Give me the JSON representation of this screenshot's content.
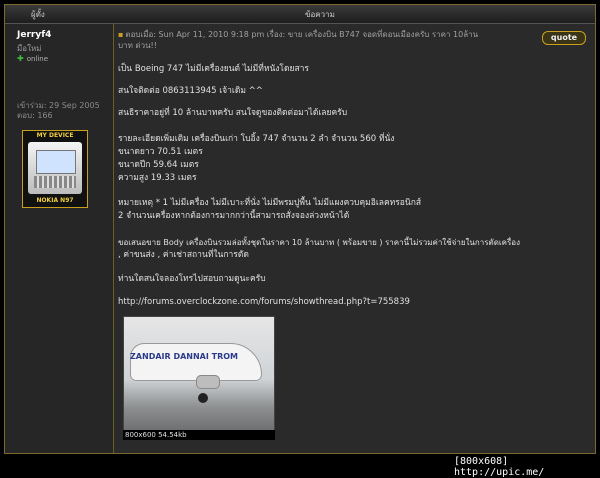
{
  "header": {
    "author": "ผู้ตั้ง",
    "message": "ข้อความ"
  },
  "user": {
    "name": "Jerryf4",
    "rank": "มือใหม่",
    "status": "online",
    "joined": "เข้าร่วม: 29 Sep 2005",
    "posts": "ตอบ: 166",
    "signature_top": "MY DEVICE",
    "signature_bottom": "NOKIA N97"
  },
  "post": {
    "subject_line1": "ตอบเมื่อ: Sun Apr 11, 2010 9:18 pm    เรื่อง: ขาย เครื่องบิน B747 จอดที่ดอนเมืองครับ ราคา 10ล้าน",
    "subject_line2": "บาท ด่วน!!",
    "quote_label": "quote",
    "lines": [
      "เป็น Boeing 747 ไม่มีเครื่องยนต์ ไม่มีที่หนังโดยสาร",
      "สนใจติดต่อ 0863113945 เจ้าเดิม ^^",
      "สนธิราคาอยู่ที่ 10 ล้านบาทครับ สนใจดูของติดต่อมาได้เลยครับ",
      "รายละเอียดเพิ่มเติม เครื่องบินเก่า โบอิ้ง 747 จำนวน 2 ลำ จำนวน 560 ที่นั่ง",
      "ขนาดยาว 70.51 เมตร",
      "ขนาดปีก 59.64 เมตร",
      "ความสูง 19.33 เมตร",
      "หมายเหตุ * 1 ไม่มีเครื่อง ไม่มีเบาะที่นั่ง ไม่มีพรมปูพื้น ไม่มีแผงควบคุมอิเลคทรอนิกส์",
      "2 จำนวนเครื่องหากต้องการมากกว่านี้สามารถสั่งจองล่วงหน้าได้",
      "ขอเสนอขาย Body เครื่องบินรวมล่อทั้งชุดในราคา 10 ล้านบาท ( พร้อมขาย ) ราคานี้ไม่รวมค่าใช้จ่ายในการตัดเครื่อง",
      ", ค่าขนส่ง , ค่าเช่าสถานที่ในการตัด",
      "ท่านใดสนใจลองโทรไปสอบถามดูนะครับ",
      "http://forums.overclockzone.com/forums/showthread.php?t=755839"
    ],
    "photo_text": "ZANDAIR DANNAI TROM",
    "image_caption": "800x600 54.54kb"
  },
  "footer": {
    "label": "[800x608] http://upic.me/"
  }
}
